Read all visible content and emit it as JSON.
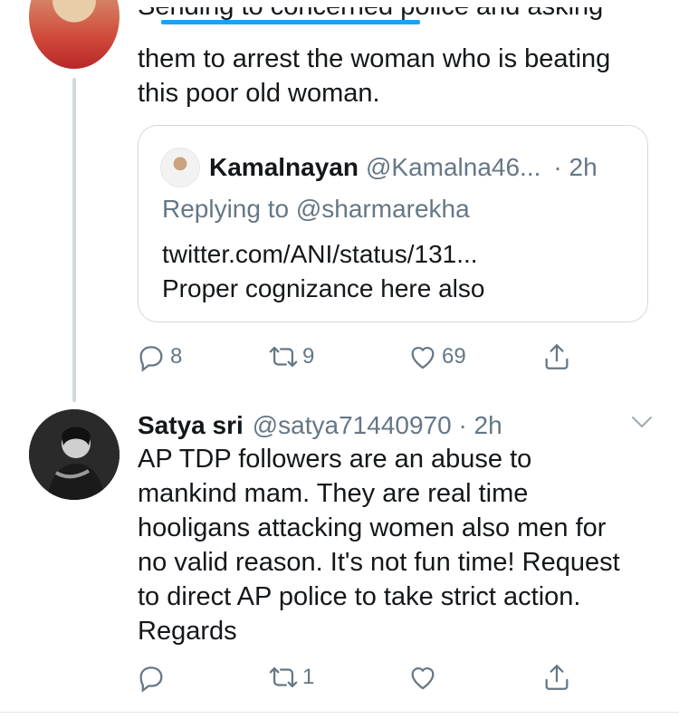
{
  "tweet_top": {
    "cut_line": "Sending to concerned police and asking",
    "line1": "them to arrest the woman who is beating",
    "line2": "this poor old woman."
  },
  "quote": {
    "name": "Kamalnayan",
    "handle": "@Kamalna46...",
    "time": "· 2h",
    "replying": "Replying to @sharmarekha",
    "link": "twitter.com/ANI/status/131...",
    "body": "Proper cognizance here also"
  },
  "actions_top": {
    "reply_count": "8",
    "retweet_count": "9",
    "like_count": "69"
  },
  "tweet2": {
    "name": "Satya sri",
    "handle_time": "@satya71440970 · 2h",
    "lines": [
      "AP TDP followers are an abuse to",
      "mankind mam. They are real time",
      "hooligans attacking women also men for",
      "no valid reason. It's not fun time! Request",
      "to direct AP police to take strict action.",
      "Regards"
    ]
  },
  "actions_bottom": {
    "retweet_count": "1"
  },
  "colors": {
    "accent": "#1da1f2",
    "icon_gray": "#657786",
    "text": "#14171a",
    "border": "#cfd9de"
  },
  "icons": [
    "reply-icon",
    "retweet-icon",
    "like-icon",
    "share-icon",
    "chevron-down-icon"
  ]
}
